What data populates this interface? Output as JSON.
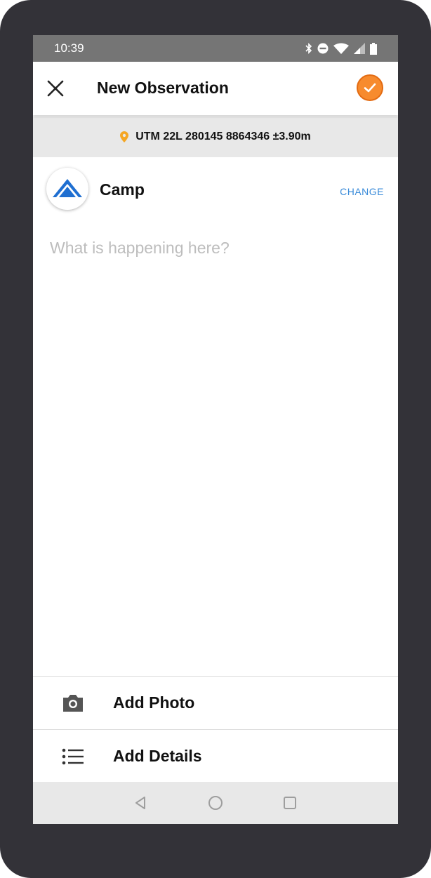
{
  "status_bar": {
    "time": "10:39",
    "icons": [
      "bluetooth-icon",
      "do-not-disturb-icon",
      "wifi-icon",
      "signal-icon",
      "battery-icon"
    ]
  },
  "app_bar": {
    "title": "New Observation",
    "close_icon": "close-icon",
    "confirm_icon": "check-icon"
  },
  "location": {
    "text": "UTM 22L 280145 8864346 ±3.90m",
    "icon": "map-pin-icon"
  },
  "category": {
    "name": "Camp",
    "icon": "camp-tent-icon",
    "change_label": "CHANGE"
  },
  "notes": {
    "value": "",
    "placeholder": "What is happening here?"
  },
  "actions": [
    {
      "label": "Add Photo",
      "icon": "camera-icon"
    },
    {
      "label": "Add Details",
      "icon": "list-icon"
    }
  ],
  "nav_bar": {
    "icons": [
      "back-icon",
      "home-icon",
      "recents-icon"
    ]
  },
  "colors": {
    "accent": "#f78b2e",
    "accent_border": "#e36b12",
    "link": "#3a8bd9",
    "pin": "#f5a623",
    "camp_icon": "#1f6fd1",
    "status_bar": "#757575",
    "device_frame": "#333238"
  }
}
